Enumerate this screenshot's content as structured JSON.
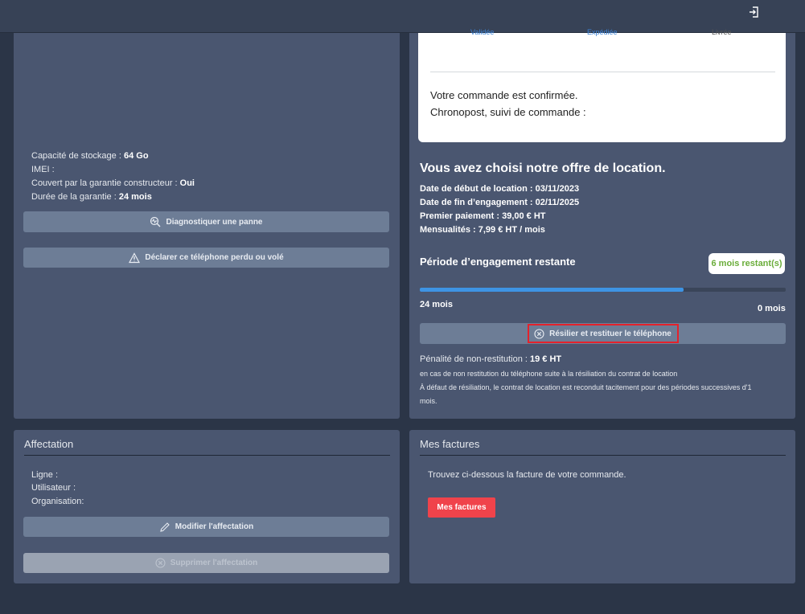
{
  "device": {
    "storage_label": "Capacité de stockage : ",
    "storage_value": "64 Go",
    "imei_label": "IMEI :",
    "warranty_label": "Couvert par la garantie constructeur : ",
    "warranty_value": "Oui",
    "warranty_duration_label": "Durée de la garantie : ",
    "warranty_duration_value": "24 mois",
    "diagnose_button": "Diagnostiquer une panne",
    "lost_button": "Déclarer ce téléphone perdu ou volé"
  },
  "order": {
    "steps": [
      "Validée",
      "Expédiée",
      "Livrée"
    ],
    "confirmed_text": "Votre commande est confirmée.",
    "tracking_text": "Chronopost, suivi de commande :"
  },
  "rental": {
    "title": "Vous avez choisi notre offre de location.",
    "start_label": "Date de début de location : ",
    "start_value": "03/11/2023",
    "end_label": "Date de fin d’engagement : ",
    "end_value": "02/11/2025",
    "first_payment_label": "Premier paiement : ",
    "first_payment_value": "39,00 € HT",
    "monthly_label": "Mensualités : ",
    "monthly_value": "7,99 € HT / mois",
    "period_title": "Période d’engagement restante",
    "remaining_badge": "6 mois restant(s)",
    "progress_fraction": 0.72,
    "progress_start_label": "24 mois",
    "progress_end_label": "0 mois",
    "terminate_button": "Résilier et restituer le téléphone",
    "penalty_label": "Pénalité de non-restitution : ",
    "penalty_value": "19 € HT",
    "note1": "en cas de non restitution du téléphone suite à la résiliation du contrat de location",
    "note2": "À défaut de résiliation, le contrat de location est reconduit tacitement pour des périodes successives d'1",
    "note3": "mois."
  },
  "assignment": {
    "title": "Affectation",
    "line_label": "Ligne :",
    "user_label": "Utilisateur :",
    "org_label": "Organisation:",
    "modify_button": "Modifier l'affectation",
    "delete_button": "Supprimer l'affectation"
  },
  "invoices": {
    "title": "Mes factures",
    "text": "Trouvez ci-dessous la facture de votre commande.",
    "button": "Mes factures"
  },
  "colors": {
    "background": "#2b3547",
    "panel": "#4a5670",
    "button": "#6d7d96",
    "accent_blue": "#3e94e4",
    "badge_green": "#6aad3a",
    "danger": "#f0434b"
  }
}
